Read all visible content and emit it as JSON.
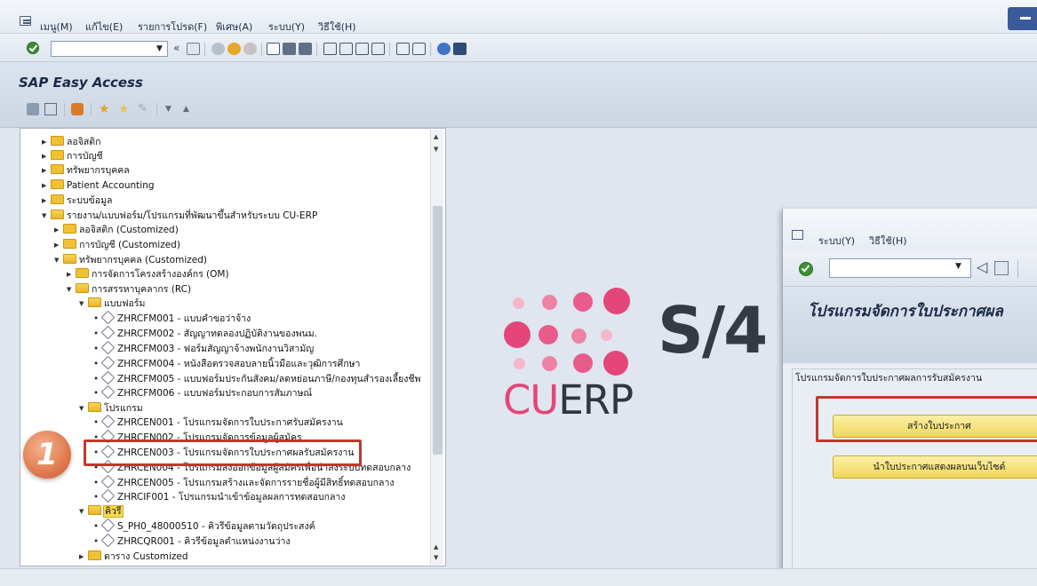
{
  "menubar": {
    "items": [
      {
        "label": "เมนู(M)"
      },
      {
        "label": "แก้ไข(E)"
      },
      {
        "label": "รายการโปรด(F)"
      },
      {
        "label": "พิเศษ(A)"
      },
      {
        "label": "ระบบ(Y)"
      },
      {
        "label": "วิธีใช้(H)"
      }
    ]
  },
  "toolbar": {
    "command_value": ""
  },
  "title": "SAP Easy Access",
  "tree": {
    "rows": [
      {
        "text": "ลอจิสติก"
      },
      {
        "text": "การบัญชี"
      },
      {
        "text": "ทรัพยากรบุคคล"
      },
      {
        "text": "Patient Accounting"
      },
      {
        "text": "ระบบข้อมูล"
      },
      {
        "text": "รายงาน/แบบฟอร์ม/โปรแกรมที่พัฒนาขึ้นสำหรับระบบ CU-ERP"
      },
      {
        "text": "ลอจิสติก (Customized)"
      },
      {
        "text": "การบัญชี (Customized)"
      },
      {
        "text": "ทรัพยากรบุคคล (Customized)"
      },
      {
        "text": "การจัดการโครงสร้างองค์กร (OM)"
      },
      {
        "text": "การสรรหาบุคลากร (RC)"
      },
      {
        "text": "แบบฟอร์ม"
      },
      {
        "text": "ZHRCFM001 - แบบคำขอว่าจ้าง"
      },
      {
        "text": "ZHRCFM002 - สัญญาทดลองปฏิบัติงานของพนม."
      },
      {
        "text": "ZHRCFM003 - ฟอร์มสัญญาจ้างพนักงานวิสามัญ"
      },
      {
        "text": "ZHRCFM004 - หนังสือตรวจสอบลายนิ้วมือและวุฒิการศึกษา"
      },
      {
        "text": "ZHRCFM005 - แบบฟอร์มประกันสังคม/ลดหย่อนภาษี/กองทุนสำรองเลี้ยงชีพ"
      },
      {
        "text": "ZHRCFM006 - แบบฟอร์มประกอบการสัมภาษณ์"
      },
      {
        "text": "โปรแกรม"
      },
      {
        "text": "ZHRCEN001 - โปรแกรมจัดการใบประกาศรับสมัครงาน"
      },
      {
        "text": "ZHRCEN002 - โปรแกรมจัดการข้อมูลผู้สมัคร"
      },
      {
        "text": "ZHRCEN003 - โปรแกรมจัดการใบประกาศผลรับสมัครงาน"
      },
      {
        "text": "ZHRCEN004 - โปรแกรมส่งออกข้อมูลผู้สมัครเพื่อนำส่งระบบทดสอบกลาง"
      },
      {
        "text": "ZHRCEN005 - โปรแกรมสร้างและจัดการรายชื่อผู้มีสิทธิ์ทดสอบกลาง"
      },
      {
        "text": "ZHRCIF001 - โปรแกรมนำเข้าข้อมูลผลการทดสอบกลาง"
      },
      {
        "text": "คิวรี"
      },
      {
        "text": "S_PH0_48000510 - คิวรีข้อมูลตามวัตถุประสงค์"
      },
      {
        "text": "ZHRCQR001 - คิวรีข้อมูลตำแหน่งงานว่าง"
      },
      {
        "text": "ตาราง Customized"
      }
    ]
  },
  "logo": {
    "s4": "S/4",
    "cu": "CU",
    "erp": "ERP",
    "dot_color": "#e5467a"
  },
  "overlay": {
    "menu": [
      {
        "label": "ระบบ(Y)"
      },
      {
        "label": "วิธีใช้(H)"
      }
    ],
    "title": "โปรแกรมจัดการใบประกาศผล",
    "group_label": "โปรแกรมจัดการใบประกาศผลการรับสมัครงาน",
    "create_button": "สร้างใบประกาศ",
    "publish_button": "นำใบประกาศแสดงผลบนเว็บไซต์"
  },
  "step_badge": "1",
  "colors": {
    "highlight": "#c0392b",
    "accent": "#e5467a",
    "button": "#f0d75a"
  }
}
